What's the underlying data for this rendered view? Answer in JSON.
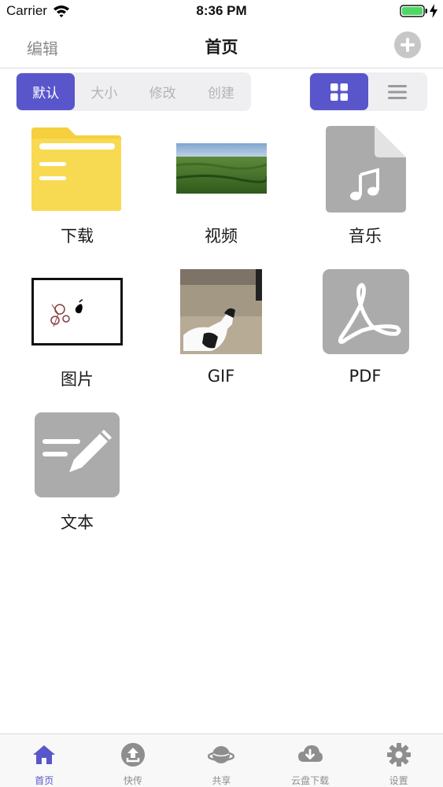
{
  "status_bar": {
    "carrier": "Carrier",
    "time": "8:36 PM",
    "battery_color": "#4cd964"
  },
  "nav": {
    "edit_label": "编辑",
    "title": "首页",
    "add_icon": "plus-circle-icon"
  },
  "sort_options": [
    {
      "label": "默认",
      "selected": true
    },
    {
      "label": "大小",
      "selected": false
    },
    {
      "label": "修改",
      "selected": false
    },
    {
      "label": "创建",
      "selected": false
    }
  ],
  "view_modes": [
    {
      "icon": "grid-icon",
      "selected": true
    },
    {
      "icon": "list-icon",
      "selected": false
    }
  ],
  "items": [
    {
      "label": "下载",
      "icon": "folder-icon"
    },
    {
      "label": "视频",
      "icon": "video-thumbnail"
    },
    {
      "label": "音乐",
      "icon": "music-file-icon"
    },
    {
      "label": "图片",
      "icon": "image-thumbnail"
    },
    {
      "label": "GIF",
      "icon": "gif-thumbnail"
    },
    {
      "label": "PDF",
      "icon": "pdf-icon"
    },
    {
      "label": "文本",
      "icon": "text-edit-icon"
    }
  ],
  "tabs": [
    {
      "label": "首页",
      "icon": "home-icon",
      "active": true
    },
    {
      "label": "快传",
      "icon": "upload-icon",
      "active": false
    },
    {
      "label": "共享",
      "icon": "planet-icon",
      "active": false
    },
    {
      "label": "云盘下载",
      "icon": "cloud-download-icon",
      "active": false
    },
    {
      "label": "设置",
      "icon": "gear-icon",
      "active": false
    }
  ],
  "colors": {
    "accent": "#5956cc",
    "folder": "#f7d84e",
    "file_icon_gray": "#ababab"
  }
}
